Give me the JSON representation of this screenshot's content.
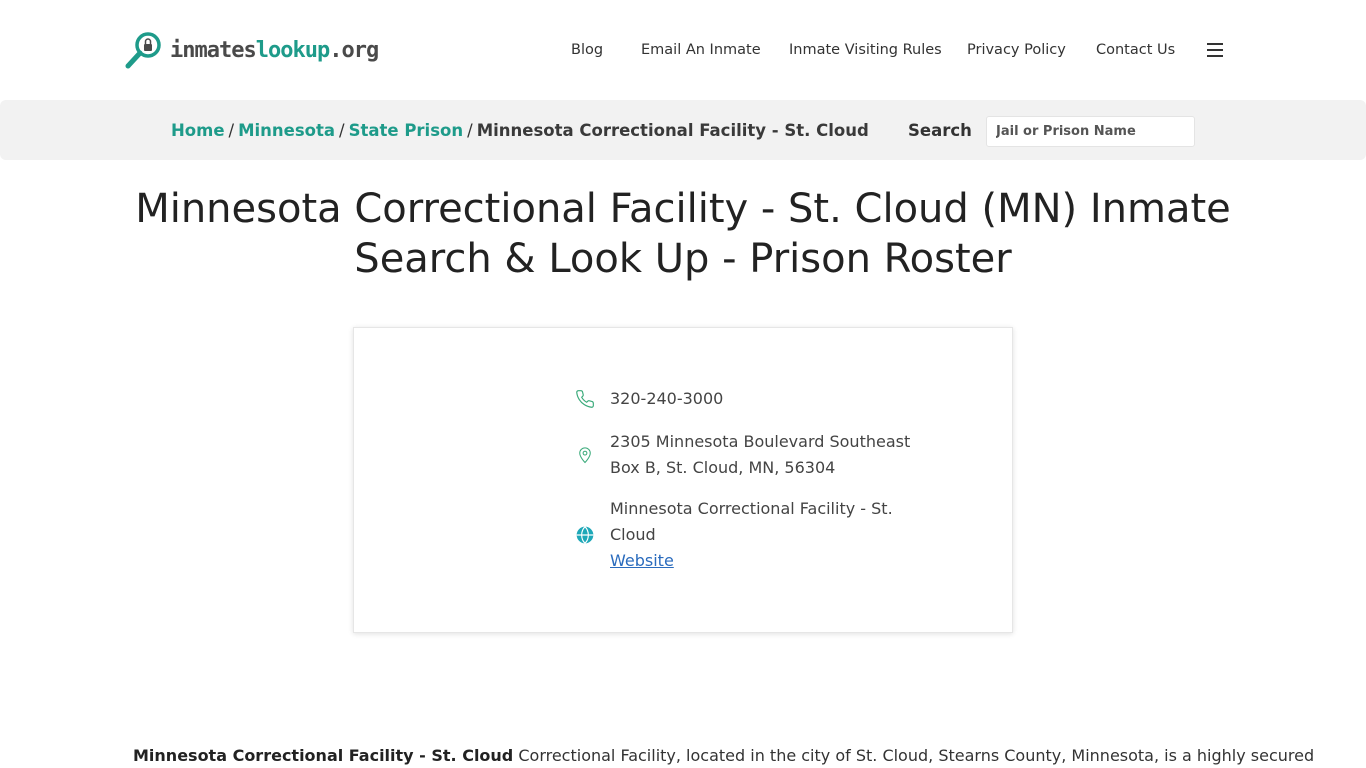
{
  "logo": {
    "part1": "inmates",
    "part2": "lookup",
    "part3": ".org",
    "icon": "magnifier-lock-icon",
    "accent_color": "#1e9b8a"
  },
  "nav": {
    "items": [
      "Blog",
      "Email An Inmate",
      "Inmate Visiting Rules",
      "Privacy Policy",
      "Contact Us"
    ],
    "menu_icon": "hamburger-icon"
  },
  "breadcrumb": {
    "home": "Home",
    "state": "Minnesota",
    "category": "State Prison",
    "current": "Minnesota Correctional Facility - St. Cloud",
    "separator": "/"
  },
  "search": {
    "label": "Search",
    "placeholder": "Jail or Prison Name"
  },
  "page": {
    "title": "Minnesota Correctional Facility - St. Cloud (MN) Inmate Search & Look Up - Prison Roster"
  },
  "card": {
    "phone": "320-240-3000",
    "address": "2305 Minnesota Boulevard Southeast Box B, St. Cloud, MN, 56304",
    "website_name": "Minnesota Correctional Facility - St. Cloud",
    "website_link": "Website"
  },
  "body": {
    "bold_name": "Minnesota Correctional Facility - St. Cloud",
    "text": " Correctional Facility, located in the city of St. Cloud, Stearns County, Minnesota, is a highly secured"
  }
}
